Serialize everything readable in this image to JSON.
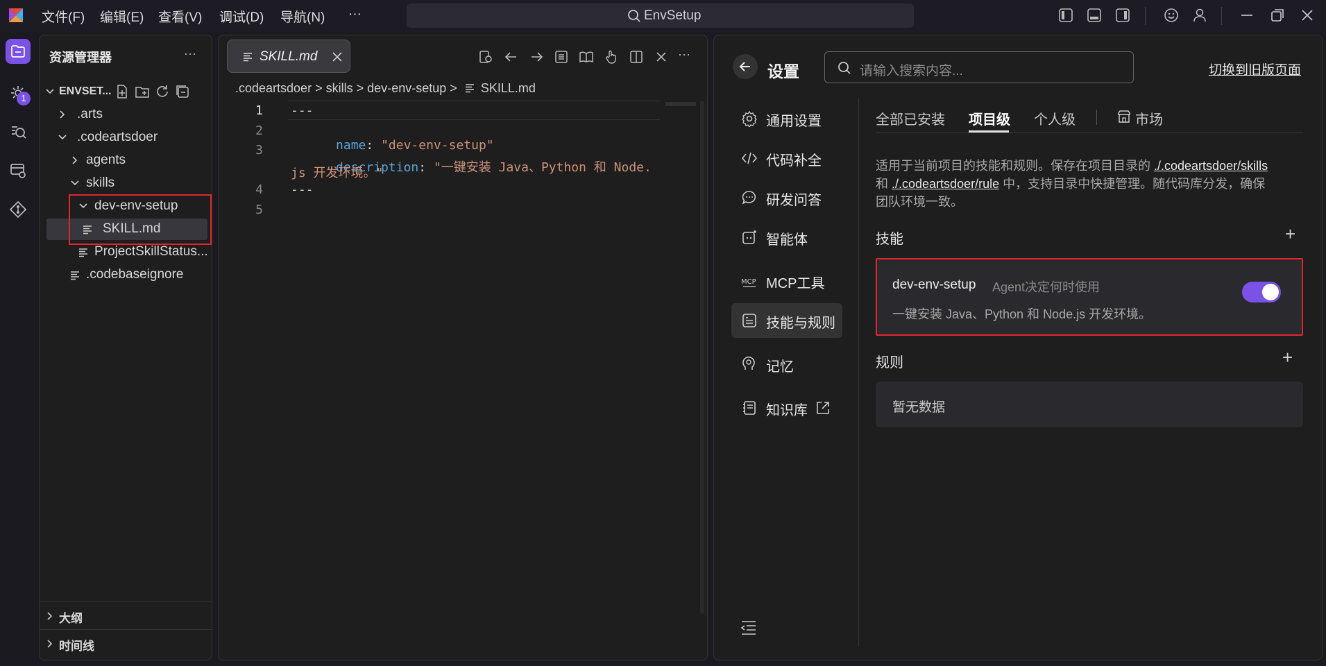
{
  "titlebar": {
    "menus": [
      "文件(F)",
      "编辑(E)",
      "查看(V)",
      "调试(D)",
      "导航(N)",
      "···"
    ],
    "search_text": "EnvSetup"
  },
  "activity": {
    "badge": "1"
  },
  "explorer": {
    "title": "资源管理器",
    "more": "···",
    "root": "ENVSET...",
    "items": [
      ".arts",
      ".codeartsdoer",
      "agents",
      "skills",
      "dev-env-setup",
      "SKILL.md",
      "ProjectSkillStatus...",
      ".codebaseignore"
    ],
    "outline": "大纲",
    "timeline": "时间线"
  },
  "editor": {
    "tab_label": "SKILL.md",
    "breadcrumb": [
      ".codeartsdoer",
      ">",
      "skills",
      ">",
      "dev-env-setup",
      ">",
      "SKILL.md"
    ],
    "line_numbers": [
      "1",
      "2",
      "3",
      "",
      "4",
      "5"
    ],
    "lines": {
      "l1": "---",
      "l2_key": "name",
      "l2_colon": ": ",
      "l2_val": "\"dev-env-setup\"",
      "l3_key": "description",
      "l3_colon": ": ",
      "l3_val_a": "\"一键安装 Java、Python 和 Node.",
      "l3_val_b": "js 开发环境。\"",
      "l4": "---"
    },
    "more": "···"
  },
  "settings": {
    "title": "设置",
    "search_placeholder": "请输入搜索内容...",
    "switch_link": "切换到旧版页面",
    "nav": [
      "通用设置",
      "代码补全",
      "研发问答",
      "智能体",
      "MCP工具",
      "技能与规则",
      "记忆",
      "知识库"
    ],
    "tabs": [
      "全部已安装",
      "项目级",
      "个人级",
      "市场"
    ],
    "desc_a": "适用于当前项目的技能和规则。保存在项目目录的 ",
    "desc_link1": "./.codeartsdoer/skills",
    "desc_b": "和 ",
    "desc_link2": "./.codeartsdoer/rule",
    "desc_c": " 中，支持目录中快捷管理。随代码库分发，确保",
    "desc_d": "团队环境一致。",
    "skills_label": "技能",
    "skill_name": "dev-env-setup",
    "skill_mode": "Agent决定何时使用",
    "skill_desc": "一键安装 Java、Python 和 Node.js 开发环境。",
    "skill_enabled": true,
    "rules_label": "规则",
    "rules_empty": "暂无数据",
    "add": "+"
  },
  "colors": {
    "accent": "#7b52e8",
    "highlight_box": "#e0262b",
    "yaml_key": "#5ba4d8",
    "yaml_string": "#ce9178"
  }
}
